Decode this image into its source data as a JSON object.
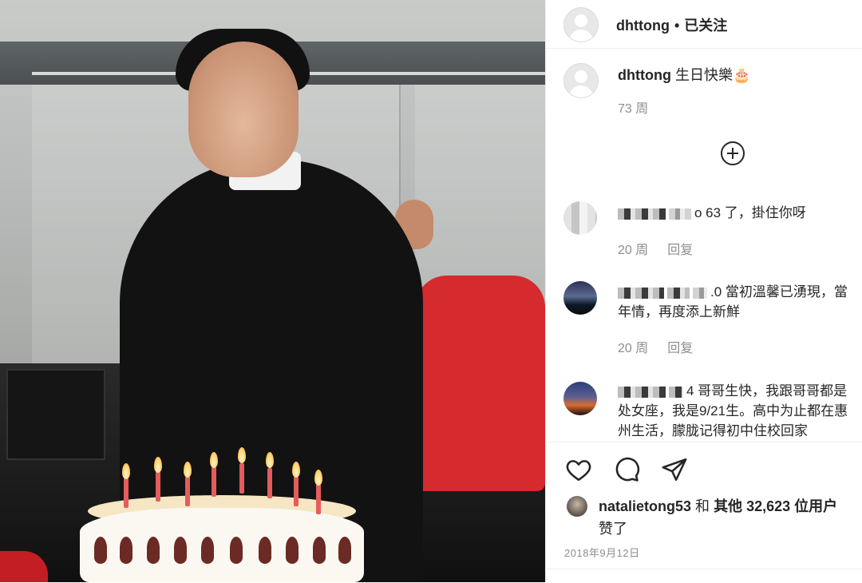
{
  "header": {
    "username": "dhttong",
    "separator": "•",
    "follow_status": "已关注"
  },
  "caption": {
    "username": "dhttong",
    "text": "生日快樂",
    "emoji": "🎂",
    "time": "73 周"
  },
  "load_more_icon": "plus-circle-icon",
  "comments": [
    {
      "text_visible": "o 63 了，掛住你呀",
      "time": "20 周",
      "reply_label": "回复"
    },
    {
      "text_visible": ".0 當初溫馨已湧現，當年情，再度添上新鮮",
      "time": "20 周",
      "reply_label": "回复"
    },
    {
      "text_visible": "4 哥哥生快，我跟哥哥都是处女座，我是9/21生。高中为止都在惠州生活，朦胧记得初中住校回家"
    }
  ],
  "actions": {
    "like_icon": "heart-icon",
    "comment_icon": "comment-icon",
    "share_icon": "send-icon"
  },
  "likes": {
    "user": "natalietong53",
    "conjunction": "和",
    "others_text": "其他 32,623 位用户",
    "suffix": "赞了"
  },
  "post_date": "2018年9月12日"
}
